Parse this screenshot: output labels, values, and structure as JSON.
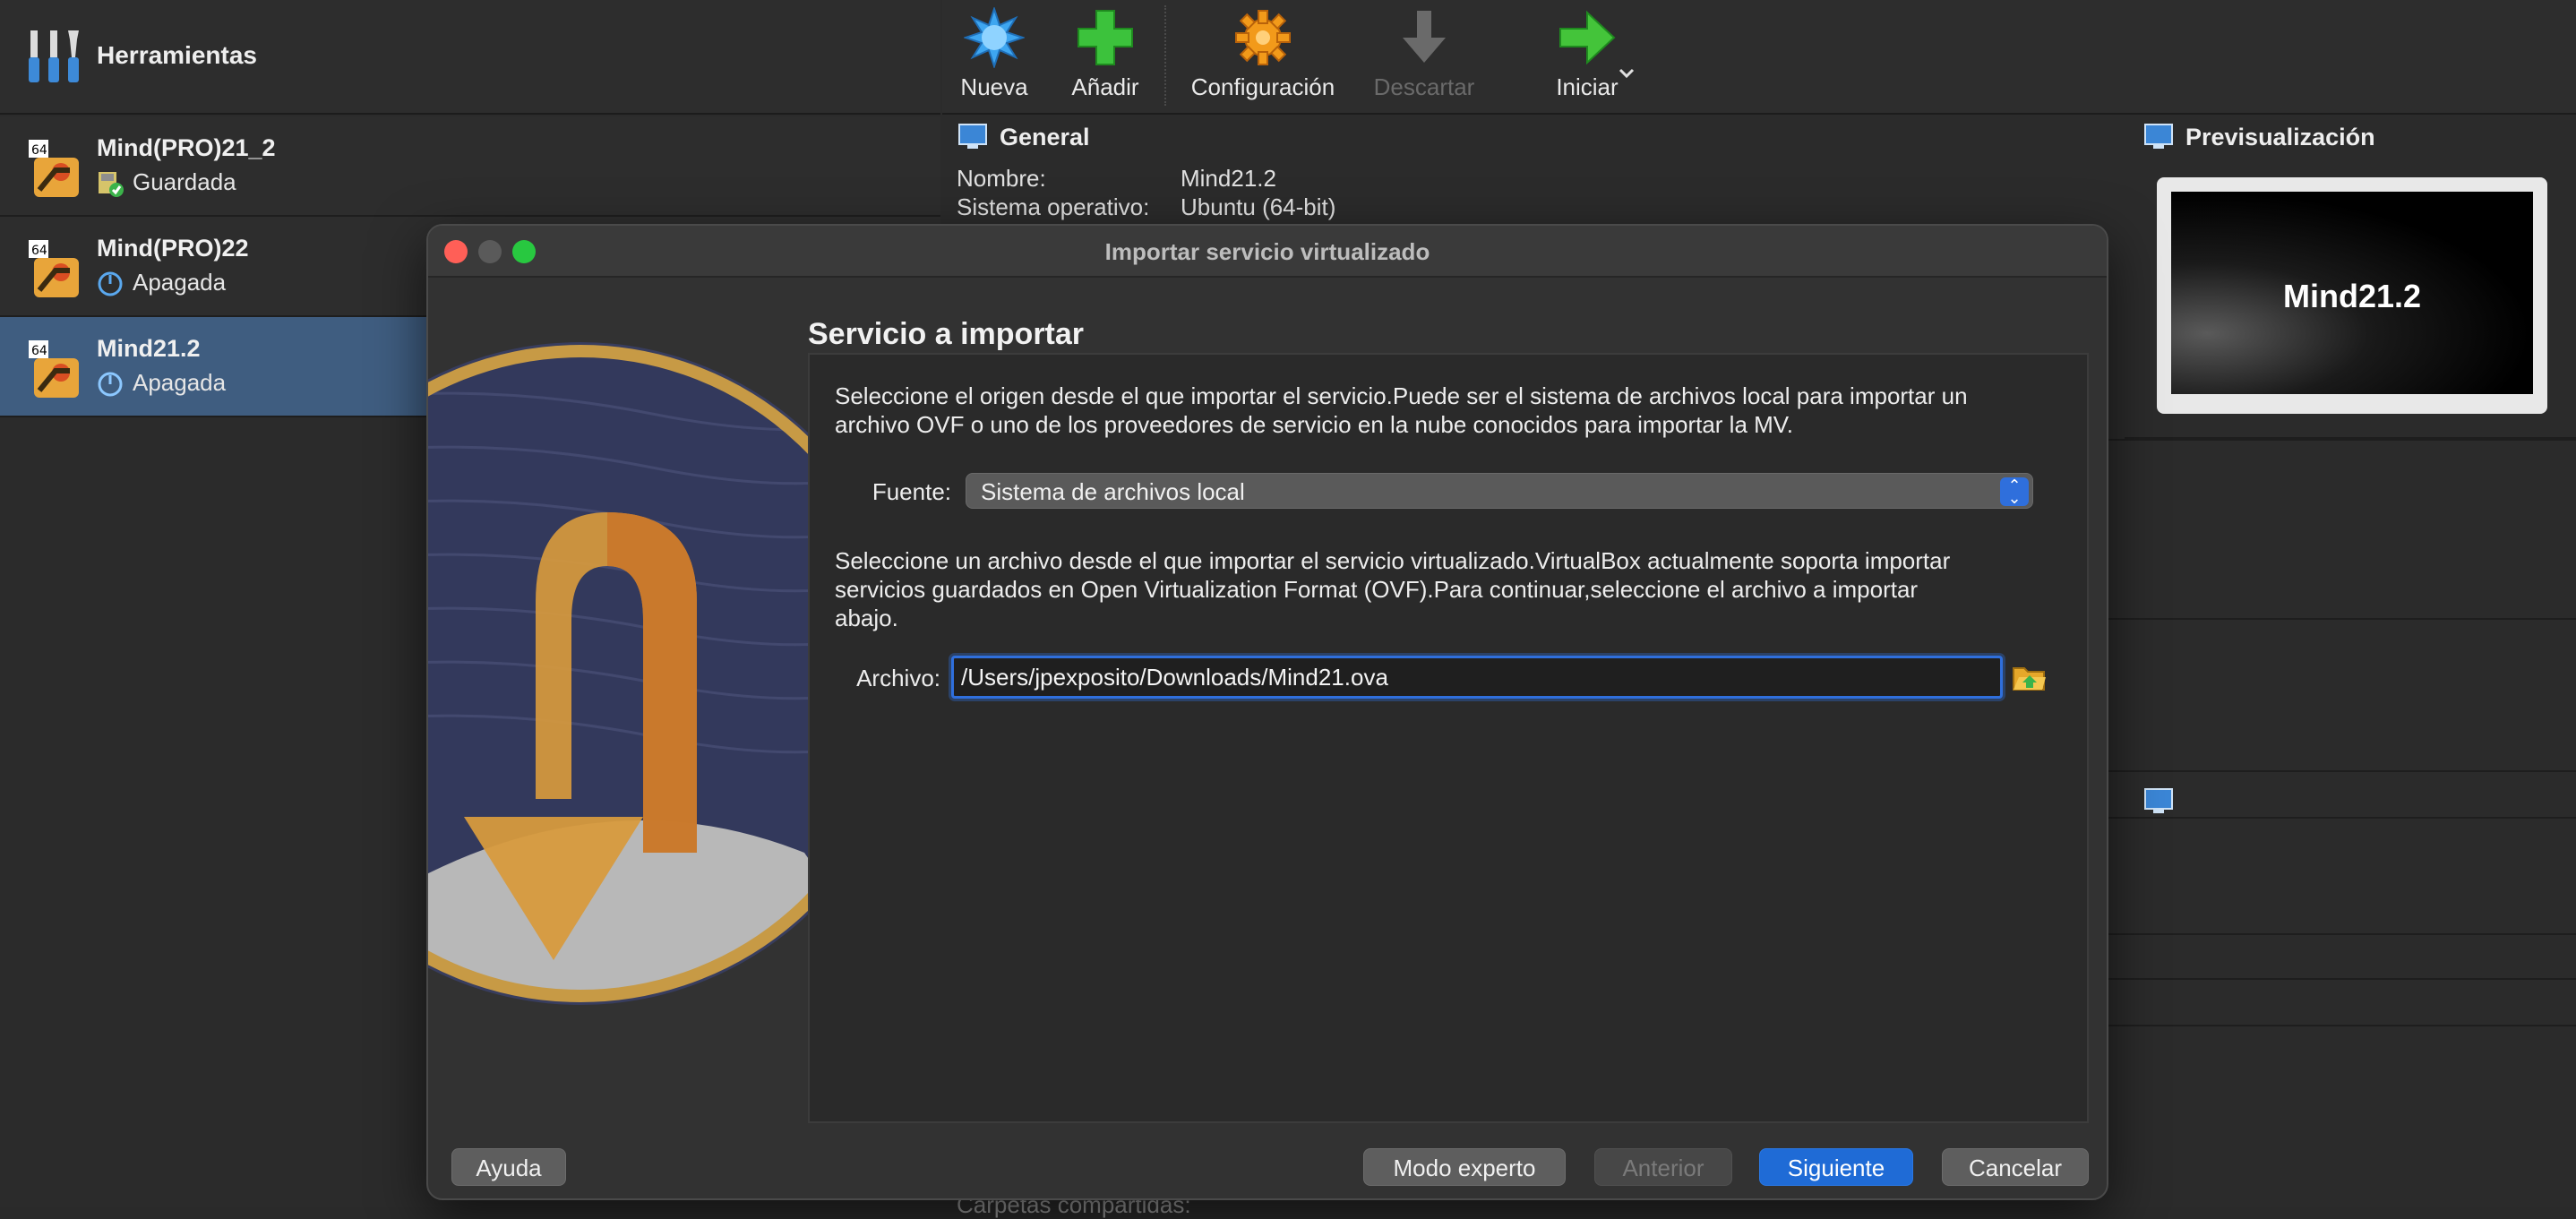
{
  "tools": {
    "label": "Herramientas"
  },
  "vm_list": [
    {
      "name": "Mind(PRO)21_2",
      "state": "Guardada",
      "badge": "64",
      "selected": false
    },
    {
      "name": "Mind(PRO)22",
      "state": "Apagada",
      "badge": "64",
      "selected": false
    },
    {
      "name": "Mind21.2",
      "state": "Apagada",
      "badge": "64",
      "selected": true
    }
  ],
  "toolbar": {
    "new_label": "Nueva",
    "add_label": "Añadir",
    "settings_label": "Configuración",
    "discard_label": "Descartar",
    "start_label": "Iniciar"
  },
  "details": {
    "general_title": "General",
    "name_label": "Nombre:",
    "name_value": "Mind21.2",
    "os_label": "Sistema operativo:",
    "os_value": "Ubuntu (64-bit)",
    "bottom_partial": "Carpetas compartidas:"
  },
  "preview": {
    "title": "Previsualización",
    "screen_text": "Mind21.2"
  },
  "dialog": {
    "title": "Importar servicio virtualizado",
    "heading": "Servicio a importar",
    "intro_line1": "Seleccione el origen desde el que importar el servicio.Puede ser el sistema de archivos local para importar un",
    "intro_line2": "archivo OVF o uno de los proveedores de servicio en la nube conocidos para importar la MV.",
    "source_label": "Fuente:",
    "source_value": "Sistema de archivos local",
    "file_line1": "Seleccione un archivo desde el que importar el servicio virtualizado.VirtualBox actualmente soporta importar",
    "file_line2": "servicios guardados en Open Virtualization Format (OVF).Para continuar,seleccione el archivo a importar",
    "file_line3": "abajo.",
    "file_label": "Archivo:",
    "file_value": "/Users/jpexposito/Downloads/Mind21.ova",
    "help_button": "Ayuda",
    "expert_button": "Modo experto",
    "back_button": "Anterior",
    "next_button": "Siguiente",
    "cancel_button": "Cancelar"
  },
  "colors": {
    "selection": "#3f5d80",
    "primary_button": "#1f6bd6",
    "accent_blue": "#2f6fdc",
    "close": "#ff5f57",
    "minimize": "#5a5a5a",
    "zoom": "#28c840"
  }
}
